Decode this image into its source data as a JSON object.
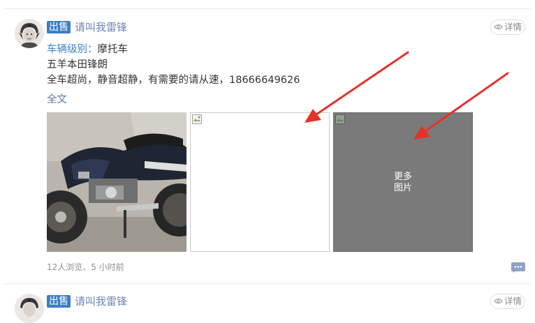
{
  "posts": [
    {
      "badge": "出售",
      "user": "请叫我雷锋",
      "detail_label": "详情",
      "level_label": "车辆级别",
      "level_sep": "：",
      "level_value": "摩托车",
      "title": "五羊本田锋朗",
      "description": "全车超尚，静音超静，有需要的请从速，18666649626",
      "full_text": "全文",
      "more_images": [
        "更多",
        "图片"
      ],
      "stats": "12人浏览、5 小时前"
    },
    {
      "badge": "出售",
      "user": "请叫我雷锋",
      "detail_label": "详情"
    }
  ],
  "colors": {
    "badge_bg": "#3b7ec6",
    "username": "#6f86b5",
    "label_blue": "#3e82c4",
    "arrow_red": "#e8312a"
  },
  "icons": [
    "eye-icon",
    "chat-bubble-icon",
    "broken-image-icon"
  ]
}
